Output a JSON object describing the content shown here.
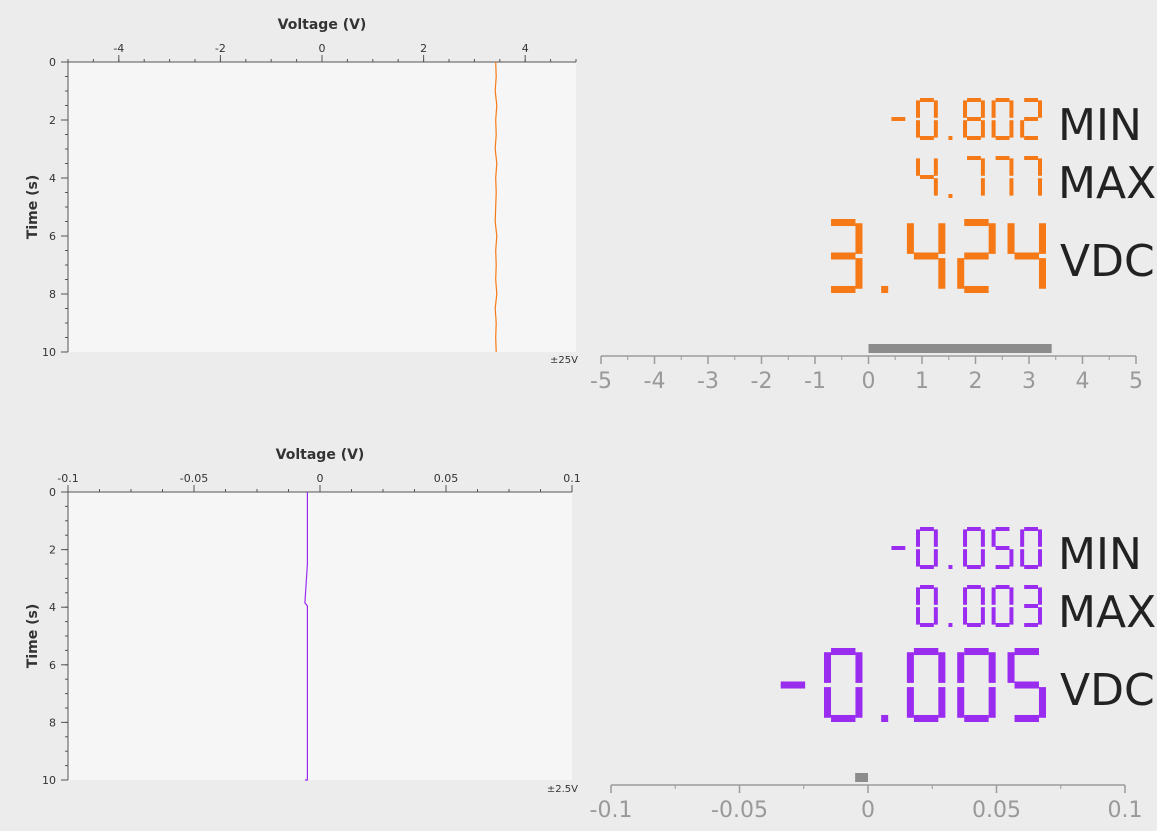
{
  "colors": {
    "background": "#ececec",
    "plot_background": "#f6f6f6",
    "channel1": "#f57a17",
    "channel2": "#9a2cf0",
    "scale_gray": "#9b9b9b",
    "scale_bar": "#8c8c8c"
  },
  "channels": [
    {
      "id": "channel1",
      "color_key": "channel1",
      "range_label": "±25V",
      "min_text": "-0.802",
      "max_text": "4.777",
      "value_text": "3.424",
      "min_label": "MIN",
      "max_label": "MAX",
      "unit_label": "VDC",
      "scale_labels": [
        "-5",
        "-4",
        "-3",
        "-2",
        "-1",
        "0",
        "1",
        "2",
        "3",
        "4",
        "5"
      ],
      "scale_range": [
        -5,
        5
      ],
      "bar_range": [
        0,
        3.424
      ],
      "chart_data": {
        "type": "line",
        "title": "",
        "xlabel": "Voltage (V)",
        "ylabel": "Time (s)",
        "xlim": [
          -5,
          5
        ],
        "ylim": [
          0,
          10
        ],
        "xticks": [
          "-4",
          "-2",
          "0",
          "2",
          "4"
        ],
        "xtick_values": [
          -4,
          -2,
          0,
          2,
          4
        ],
        "yticks": [
          "0",
          "2",
          "4",
          "6",
          "8",
          "10"
        ],
        "ytick_values": [
          0,
          2,
          4,
          6,
          8,
          10
        ],
        "series": [
          {
            "x": [
              3.42,
              3.43,
              3.41,
              3.44,
              3.42,
              3.43,
              3.41,
              3.44,
              3.42,
              3.43,
              3.42,
              3.41,
              3.44,
              3.42,
              3.43,
              3.42,
              3.44,
              3.41,
              3.43,
              3.42,
              3.43
            ],
            "y": [
              0,
              0.5,
              1,
              1.5,
              2,
              2.5,
              3,
              3.5,
              4,
              4.5,
              5,
              5.5,
              6,
              6.5,
              7,
              7.5,
              8,
              8.5,
              9,
              9.5,
              10
            ]
          }
        ]
      }
    },
    {
      "id": "channel2",
      "color_key": "channel2",
      "range_label": "±2.5V",
      "min_text": "-0.050",
      "max_text": "0.003",
      "value_text": "-0.005",
      "min_label": "MIN",
      "max_label": "MAX",
      "unit_label": "VDC",
      "scale_labels": [
        "-0.1",
        "-0.05",
        "0",
        "0.05",
        "0.1"
      ],
      "scale_range": [
        -0.1,
        0.1
      ],
      "bar_range": [
        -0.005,
        0
      ],
      "chart_data": {
        "type": "line",
        "title": "",
        "xlabel": "Voltage (V)",
        "ylabel": "Time (s)",
        "xlim": [
          -0.1,
          0.1
        ],
        "ylim": [
          0,
          10
        ],
        "xticks": [
          "-0.1",
          "-0.05",
          "0",
          "0.05",
          "0.1"
        ],
        "xtick_values": [
          -0.1,
          -0.05,
          0,
          0.05,
          0.1
        ],
        "yticks": [
          "0",
          "2",
          "4",
          "6",
          "8",
          "10"
        ],
        "ytick_values": [
          0,
          2,
          4,
          6,
          8,
          10
        ],
        "series": [
          {
            "x": [
              -0.005,
              -0.005,
              -0.005,
              -0.005,
              -0.005,
              -0.005,
              -0.005,
              -0.005,
              -0.005,
              -0.006,
              -0.005,
              -0.005,
              -0.005,
              -0.005,
              -0.005,
              -0.005,
              -0.005,
              -0.005,
              -0.005,
              -0.005,
              -0.005,
              -0.005,
              -0.005,
              -0.005,
              -0.005,
              -0.005,
              -0.005,
              -0.005,
              -0.006,
              -0.005,
              -0.005,
              -0.005,
              -0.005,
              -0.005,
              -0.005,
              -0.005,
              -0.005,
              -0.005,
              -0.005,
              -0.006,
              -0.005
            ],
            "y": [
              0,
              0.2,
              0.4,
              1.2,
              1.35,
              1.5,
              1.65,
              1.8,
              2.5,
              3.85,
              3.95,
              4.05,
              4.6,
              4.8,
              4.9,
              5.2,
              6,
              7,
              8,
              9.5,
              9.6,
              9.7,
              9.9,
              10,
              10,
              10,
              10,
              10,
              10,
              10,
              10,
              10,
              10,
              10,
              10,
              10,
              10,
              10,
              10,
              10,
              10
            ]
          }
        ]
      }
    }
  ]
}
